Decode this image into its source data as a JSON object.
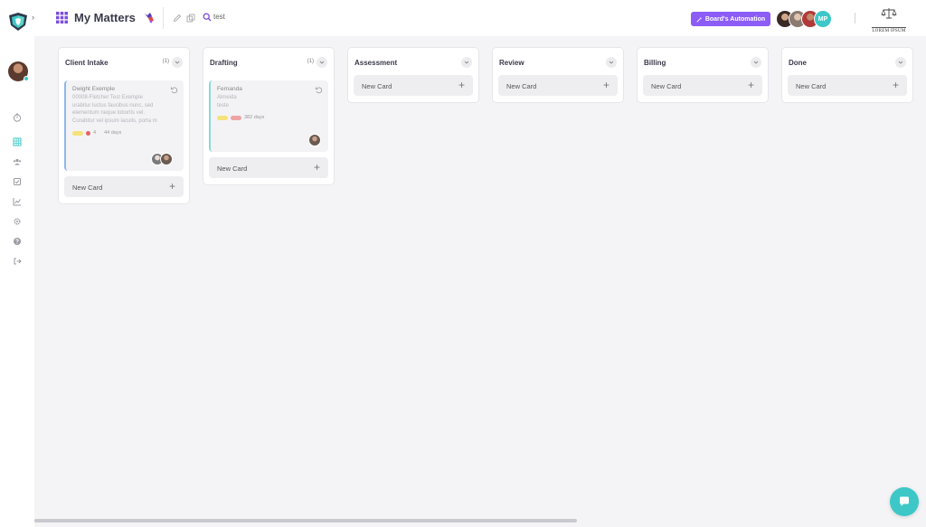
{
  "header": {
    "title": "My Matters",
    "search_value": "test",
    "automation_label": "Board's Automation",
    "avatar_initials": "MP",
    "brand_name": "LOREM IPSUM"
  },
  "colors": {
    "accent": "#8b5cf6",
    "teal": "#3ec7c7",
    "card_border_blue": "#8fb7e8",
    "card_border_teal": "#8ad9d9",
    "tag_yellow": "#f5e27a",
    "tag_red": "#f0a3a3"
  },
  "sidebar": {
    "icons": [
      "timer-icon",
      "board-icon",
      "users-icon",
      "tasks-icon",
      "chart-icon",
      "settings-icon",
      "help-icon",
      "logout-icon"
    ]
  },
  "columns": [
    {
      "title": "Client Intake",
      "count": "(1)",
      "new_card": "New Card",
      "cards": [
        {
          "name": "Dwight Exemple",
          "lines": [
            "00008-Fletcher Test Exemple",
            "urabitur luctus faucibus nunc, sed",
            "elementum neque lobortis vel.",
            "Curabitur vel ipsum iaculis, porta m"
          ],
          "alert_count": "4",
          "days": "44 days"
        }
      ]
    },
    {
      "title": "Drafting",
      "count": "(1)",
      "new_card": "New Card",
      "cards": [
        {
          "name": "Fernanda",
          "lines": [
            "Almeida",
            "teste"
          ],
          "days": "382 days"
        }
      ]
    },
    {
      "title": "Assessment",
      "new_card": "New Card",
      "cards": []
    },
    {
      "title": "Review",
      "new_card": "New Card",
      "cards": []
    },
    {
      "title": "Billing",
      "new_card": "New Card",
      "cards": []
    },
    {
      "title": "Done",
      "new_card": "New Card",
      "cards": []
    }
  ]
}
